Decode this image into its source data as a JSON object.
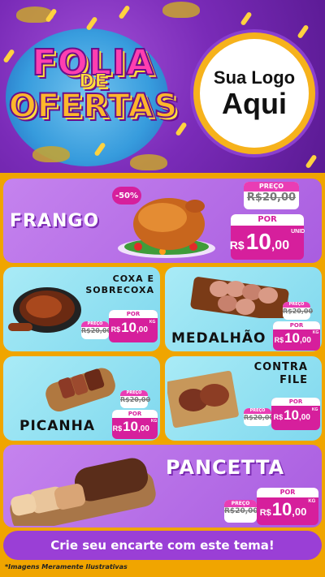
{
  "header": {
    "logo_line1": "FOLIA",
    "logo_line2": "DE",
    "logo_line3": "OFERTAS",
    "brand_line1": "Sua Logo",
    "brand_line2": "Aqui"
  },
  "products": {
    "frango": {
      "name": "FRANGO",
      "discount": "-50%",
      "old_label": "PREÇO",
      "old_price": "R$20,00",
      "por_label": "POR",
      "currency": "R$",
      "price_int": "10",
      "price_dec": ",00",
      "unit": "UNID"
    },
    "coxa": {
      "name_line1": "COXA E",
      "name_line2": "SOBRECOXA",
      "old_label": "PREÇO",
      "old_price": "R$20,00",
      "por_label": "POR",
      "currency": "R$",
      "price_int": "10",
      "price_dec": ",00",
      "unit": "KG"
    },
    "medalhao": {
      "name": "MEDALHÃO",
      "old_label": "PREÇO",
      "old_price": "R$20,00",
      "por_label": "POR",
      "currency": "R$",
      "price_int": "10",
      "price_dec": ",00",
      "unit": "KG"
    },
    "picanha": {
      "name": "PICANHA",
      "old_label": "PREÇO",
      "old_price": "R$20,00",
      "por_label": "POR",
      "currency": "R$",
      "price_int": "10",
      "price_dec": ",00",
      "unit": "KG"
    },
    "contrafile": {
      "name_line1": "CONTRA",
      "name_line2": "FILE",
      "old_label": "PREÇO",
      "old_price": "R$20,00",
      "por_label": "POR",
      "currency": "R$",
      "price_int": "10",
      "price_dec": ",00",
      "unit": "KG"
    },
    "pancetta": {
      "name": "PANCETTA",
      "old_label": "PREÇO",
      "old_price": "R$20,00",
      "por_label": "POR",
      "currency": "R$",
      "price_int": "10",
      "price_dec": ",00",
      "unit": "KG"
    }
  },
  "footer": {
    "cta": "Crie seu encarte com este tema!",
    "disclaimer": "*Imagens Meramente Ilustrativas"
  },
  "colors": {
    "header_purple": "#7a2bb8",
    "panel_purple": "#b66ae5",
    "panel_cyan": "#8fdff1",
    "price_magenta": "#d61f9c",
    "background_gold": "#f0a500"
  }
}
